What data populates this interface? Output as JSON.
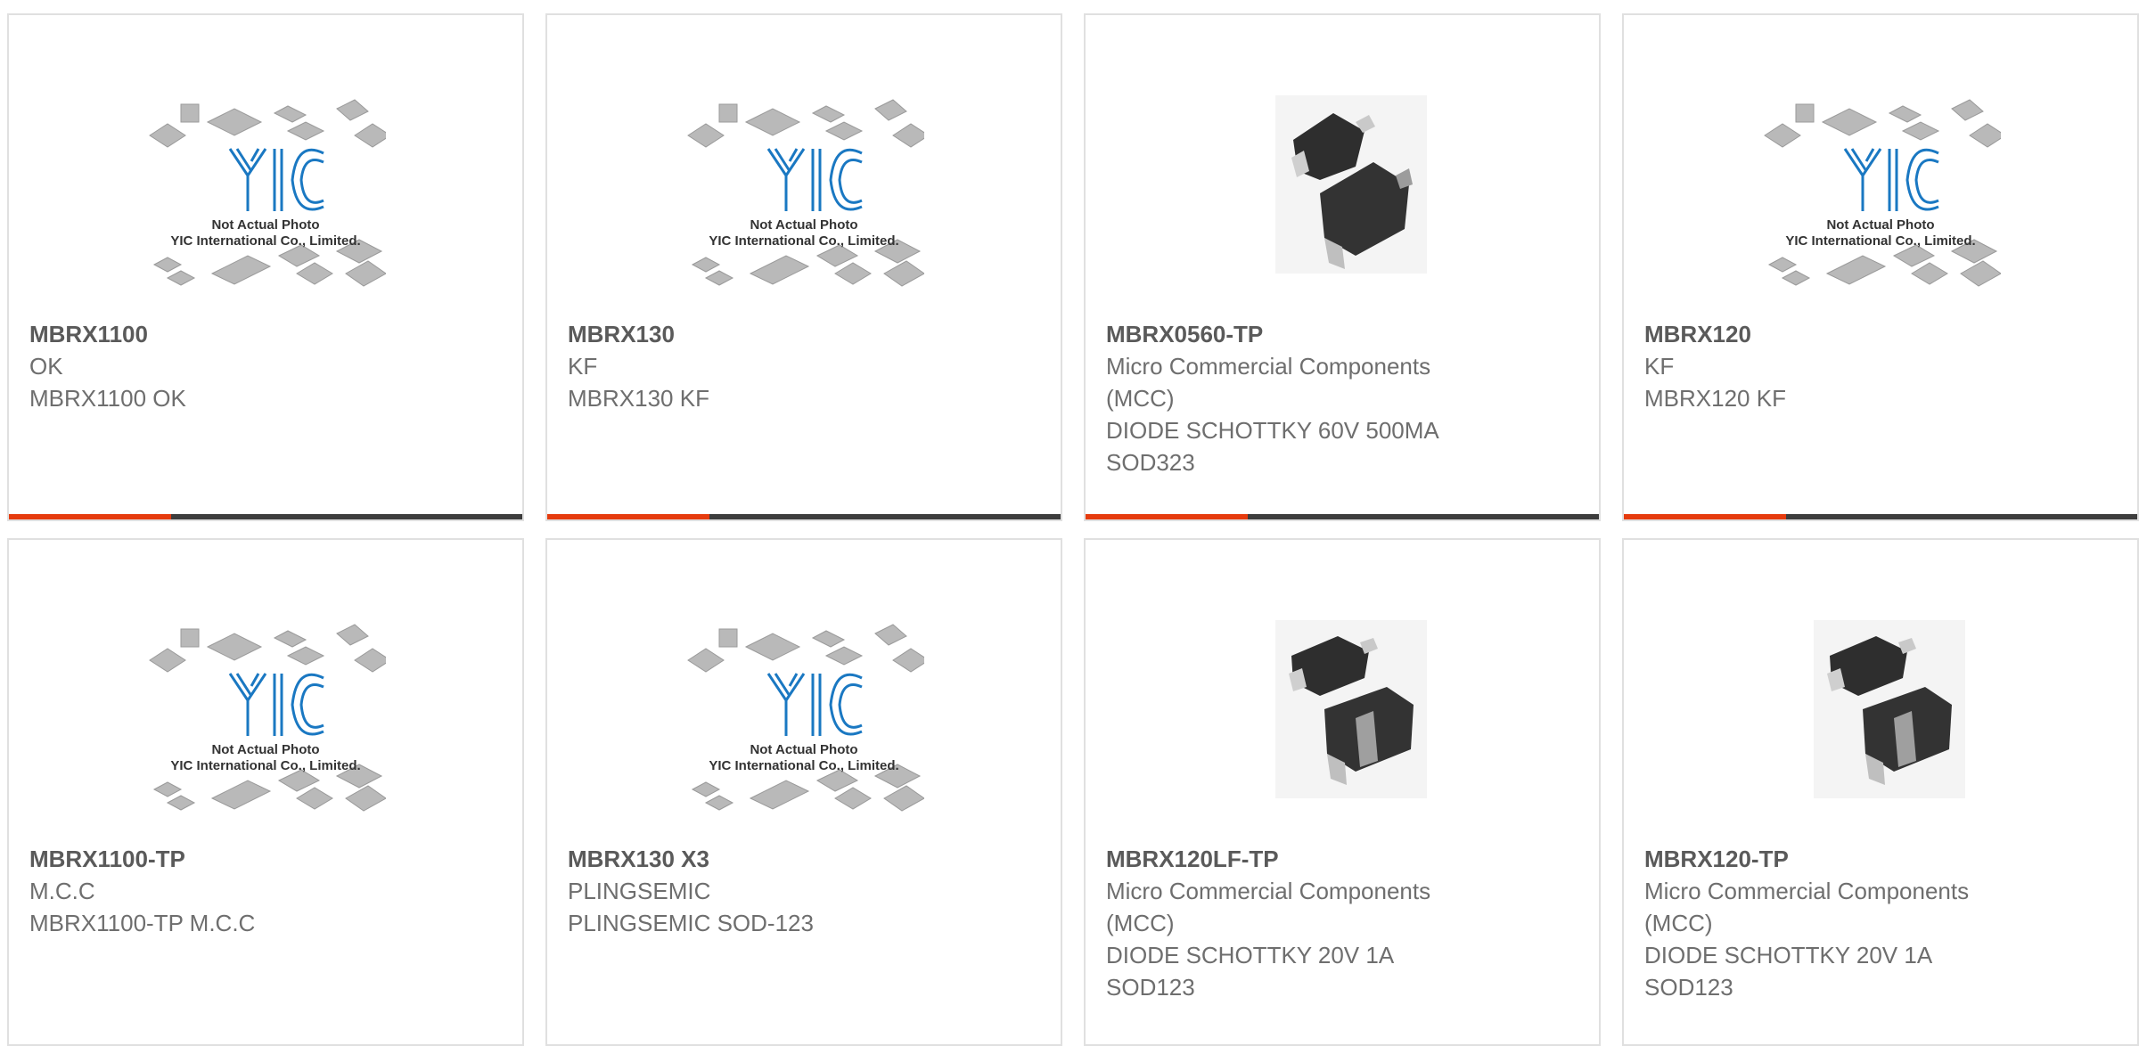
{
  "colors": {
    "accent": "#e63b0e",
    "bar": "#3d3d3d",
    "card_border": "#e0e0e0",
    "text": "#6e6e6e",
    "logo_blue": "#1a78c2"
  },
  "placeholder": {
    "line1": "Not Actual Photo",
    "line2": "YIC International Co., Limited."
  },
  "products": [
    {
      "part": "MBRX1100",
      "manufacturer": "OK",
      "description": "MBRX1100 OK",
      "image": "placeholder"
    },
    {
      "part": "MBRX130",
      "manufacturer": "KF",
      "description": "MBRX130 KF",
      "image": "placeholder"
    },
    {
      "part": "MBRX0560-TP",
      "manufacturer": "Micro Commercial Components (MCC)",
      "description": "DIODE SCHOTTKY 60V 500MA SOD323",
      "image": "diode-photo"
    },
    {
      "part": "MBRX120",
      "manufacturer": "KF",
      "description": "MBRX120 KF",
      "image": "placeholder"
    },
    {
      "part": "MBRX1100-TP",
      "manufacturer": "M.C.C",
      "description": "MBRX1100-TP M.C.C",
      "image": "placeholder"
    },
    {
      "part": "MBRX130 X3",
      "manufacturer": "PLINGSEMIC",
      "description": "PLINGSEMIC SOD-123",
      "image": "placeholder"
    },
    {
      "part": "MBRX120LF-TP",
      "manufacturer": "Micro Commercial Components (MCC)",
      "description": "DIODE SCHOTTKY 20V 1A SOD123",
      "image": "diode-photo"
    },
    {
      "part": "MBRX120-TP",
      "manufacturer": "Micro Commercial Components (MCC)",
      "description": "DIODE SCHOTTKY 20V 1A SOD123",
      "image": "diode-photo"
    }
  ]
}
